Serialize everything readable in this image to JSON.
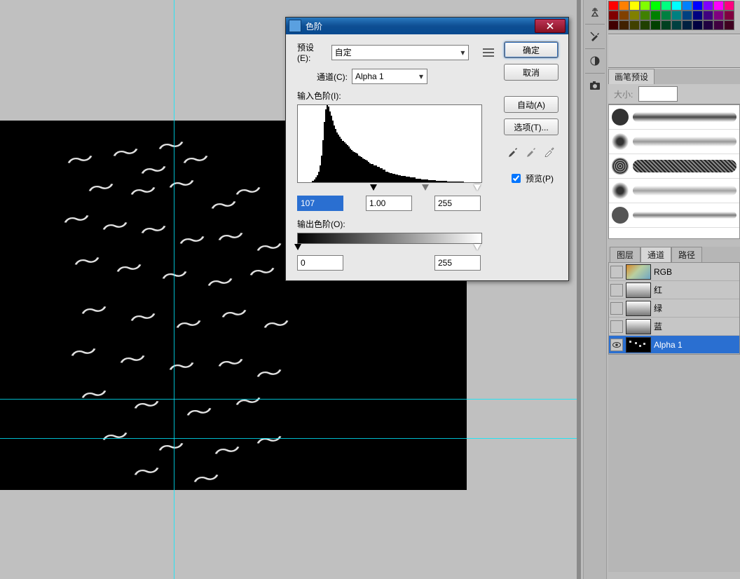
{
  "dialog": {
    "title": "色阶",
    "preset_label": "预设(E):",
    "preset_value": "自定",
    "channel_label": "通道(C):",
    "channel_value": "Alpha 1",
    "input_levels_label": "输入色阶(I):",
    "output_levels_label": "输出色阶(O):",
    "shadow": "107",
    "mid": "1.00",
    "highlight": "255",
    "out_shadow": "0",
    "out_highlight": "255",
    "ok": "确定",
    "cancel": "取消",
    "auto": "自动(A)",
    "options": "选项(T)...",
    "preview": "预览(P)"
  },
  "brush_panel": {
    "tab": "画笔预设",
    "size_label": "大小:"
  },
  "channels": {
    "tab_layers": "图层",
    "tab_channels": "通道",
    "tab_paths": "路径",
    "rgb": "RGB",
    "red": "红",
    "green": "绿",
    "blue": "蓝",
    "alpha": "Alpha 1"
  },
  "swatch_colors": [
    [
      "#ff0000",
      "#ff8000",
      "#ffff00",
      "#80ff00",
      "#00ff00",
      "#00ff80",
      "#00ffff",
      "#0080ff",
      "#0000ff",
      "#8000ff",
      "#ff00ff",
      "#ff0080"
    ],
    [
      "#800000",
      "#804000",
      "#808000",
      "#408000",
      "#008000",
      "#008040",
      "#008080",
      "#004080",
      "#000080",
      "#400080",
      "#800080",
      "#800040"
    ],
    [
      "#400000",
      "#402000",
      "#404000",
      "#204000",
      "#004000",
      "#004020",
      "#004040",
      "#002040",
      "#000040",
      "#200040",
      "#400040",
      "#400020"
    ]
  ],
  "chart_data": {
    "type": "bar",
    "title": "",
    "xlabel": "",
    "ylabel": "",
    "xlim": [
      0,
      255
    ],
    "ylim": [
      0,
      100
    ],
    "values": [
      0,
      0,
      0,
      0,
      0,
      0,
      0,
      0,
      0,
      0,
      2,
      4,
      6,
      9,
      14,
      22,
      35,
      55,
      78,
      95,
      100,
      98,
      92,
      86,
      80,
      74,
      69,
      65,
      62,
      59,
      56,
      54,
      52,
      50,
      48,
      46,
      44,
      42,
      40,
      39,
      38,
      37,
      35,
      34,
      33,
      31,
      30,
      29,
      28,
      26,
      25,
      24,
      24,
      22,
      22,
      20,
      20,
      18,
      18,
      16,
      16,
      14,
      14,
      13,
      12,
      12,
      11,
      11,
      10,
      10,
      9,
      9,
      8,
      8,
      8,
      7,
      7,
      7,
      6,
      6,
      6,
      6,
      5,
      5,
      5,
      5,
      4,
      4,
      4,
      4,
      4,
      3,
      3,
      3,
      3,
      3,
      2,
      2,
      2,
      2,
      2,
      2,
      2,
      2,
      1,
      1,
      1,
      1,
      1,
      1,
      1,
      1,
      1,
      1,
      1,
      1,
      0,
      0,
      0,
      0,
      0,
      0,
      0,
      0,
      0,
      0,
      0,
      0
    ]
  }
}
